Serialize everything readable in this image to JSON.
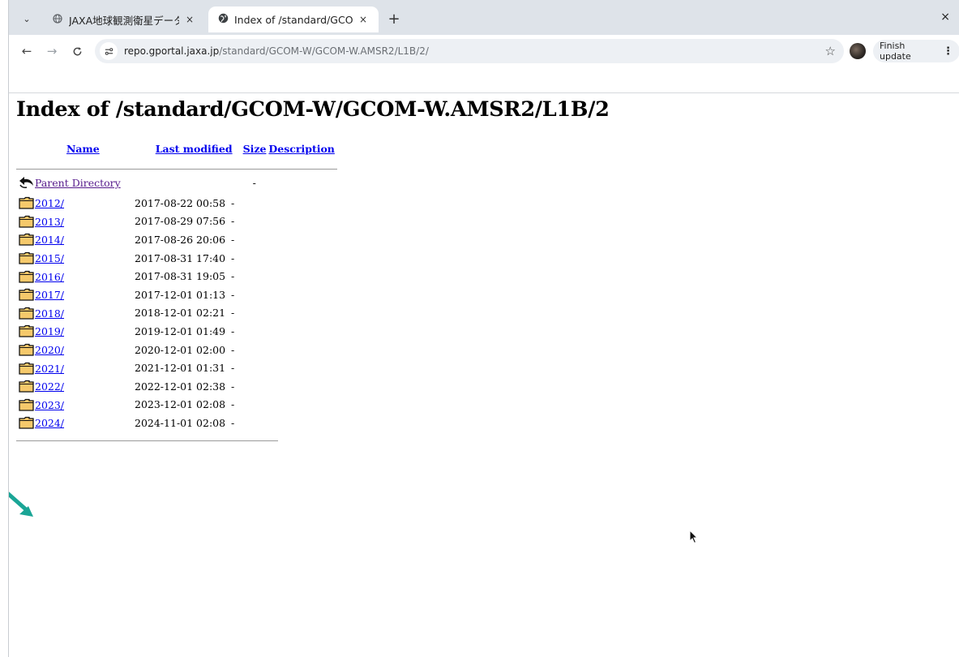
{
  "browser": {
    "tabs": [
      {
        "title": "JAXA地球観測衛星データ",
        "active": false
      },
      {
        "title": "Index of /standard/GCOM",
        "active": true
      }
    ],
    "new_tab_label": "+",
    "window_close_label": "×",
    "tab_close_label": "×",
    "tab_search_label": "⌄",
    "nav": {
      "back": "←",
      "forward": "→",
      "reload": "C"
    },
    "url": {
      "host": "repo.gportal.jaxa.jp",
      "path": "/standard/GCOM-W/GCOM-W.AMSR2/L1B/2/"
    },
    "bookmark_star": "☆",
    "finish_update_label": "Finish update",
    "menu_label": "⋮"
  },
  "page": {
    "heading": "Index of /standard/GCOM-W/GCOM-W.AMSR2/L1B/2",
    "columns": {
      "name": "Name",
      "last_modified": "Last modified",
      "size": "Size",
      "description": "Description"
    },
    "parent": {
      "name": "Parent Directory",
      "size": "-"
    },
    "rows": [
      {
        "name": "2012/",
        "modified": "2017-08-22 00:58",
        "size": "-"
      },
      {
        "name": "2013/",
        "modified": "2017-08-29 07:56",
        "size": "-"
      },
      {
        "name": "2014/",
        "modified": "2017-08-26 20:06",
        "size": "-"
      },
      {
        "name": "2015/",
        "modified": "2017-08-31 17:40",
        "size": "-"
      },
      {
        "name": "2016/",
        "modified": "2017-08-31 19:05",
        "size": "-"
      },
      {
        "name": "2017/",
        "modified": "2017-12-01 01:13",
        "size": "-"
      },
      {
        "name": "2018/",
        "modified": "2018-12-01 02:21",
        "size": "-"
      },
      {
        "name": "2019/",
        "modified": "2019-12-01 01:49",
        "size": "-"
      },
      {
        "name": "2020/",
        "modified": "2020-12-01 02:00",
        "size": "-"
      },
      {
        "name": "2021/",
        "modified": "2021-12-01 01:31",
        "size": "-"
      },
      {
        "name": "2022/",
        "modified": "2022-12-01 02:38",
        "size": "-"
      },
      {
        "name": "2023/",
        "modified": "2023-12-01 02:08",
        "size": "-"
      },
      {
        "name": "2024/",
        "modified": "2024-11-01 02:08",
        "size": "-"
      }
    ]
  },
  "colors": {
    "link": "#0000ee",
    "visited": "#551a8b",
    "annotation_arrow": "#1aa596",
    "tabstrip": "#dee3e9"
  },
  "icons": {
    "folder": "folder-icon",
    "parent": "back-arrow-icon",
    "globe": "globe-icon"
  }
}
